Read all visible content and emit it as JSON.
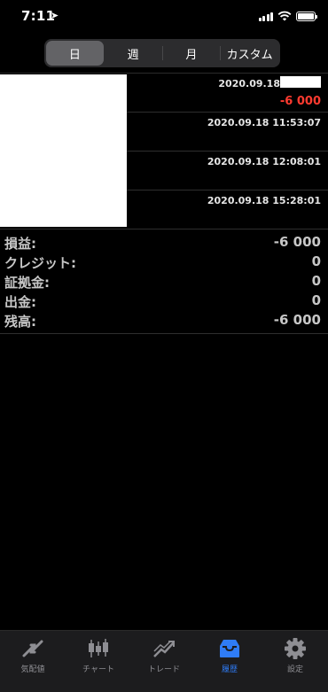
{
  "status": {
    "time": "7:11"
  },
  "segments": [
    {
      "label": "日",
      "active": true
    },
    {
      "label": "週",
      "active": false
    },
    {
      "label": "月",
      "active": false
    },
    {
      "label": "カスタム",
      "active": false
    }
  ],
  "history": [
    {
      "date": "2020.09.18",
      "amount": "-6 000",
      "masked": true
    },
    {
      "date": "2020.09.18 11:53:07",
      "amount": ""
    },
    {
      "date": "2020.09.18 12:08:01",
      "amount": ""
    },
    {
      "date": "2020.09.18 15:28:01",
      "amount": ""
    }
  ],
  "summary": [
    {
      "label": "損益:",
      "value": "-6 000"
    },
    {
      "label": "クレジット:",
      "value": "0"
    },
    {
      "label": "証拠金:",
      "value": "0"
    },
    {
      "label": "出金:",
      "value": "0"
    },
    {
      "label": "残高:",
      "value": "-6 000"
    }
  ],
  "tabs": [
    {
      "label": "気配値",
      "icon": "quotes-arrows-icon",
      "active": false
    },
    {
      "label": "チャート",
      "icon": "candlestick-chart-icon",
      "active": false
    },
    {
      "label": "トレード",
      "icon": "trade-chart-icon",
      "active": false
    },
    {
      "label": "履歴",
      "icon": "inbox-tray-icon",
      "active": true
    },
    {
      "label": "設定",
      "icon": "gear-icon",
      "active": false
    }
  ],
  "colors": {
    "negative": "#ff3b30",
    "accent": "#2f7cf6",
    "inactive": "#8e8e93"
  }
}
